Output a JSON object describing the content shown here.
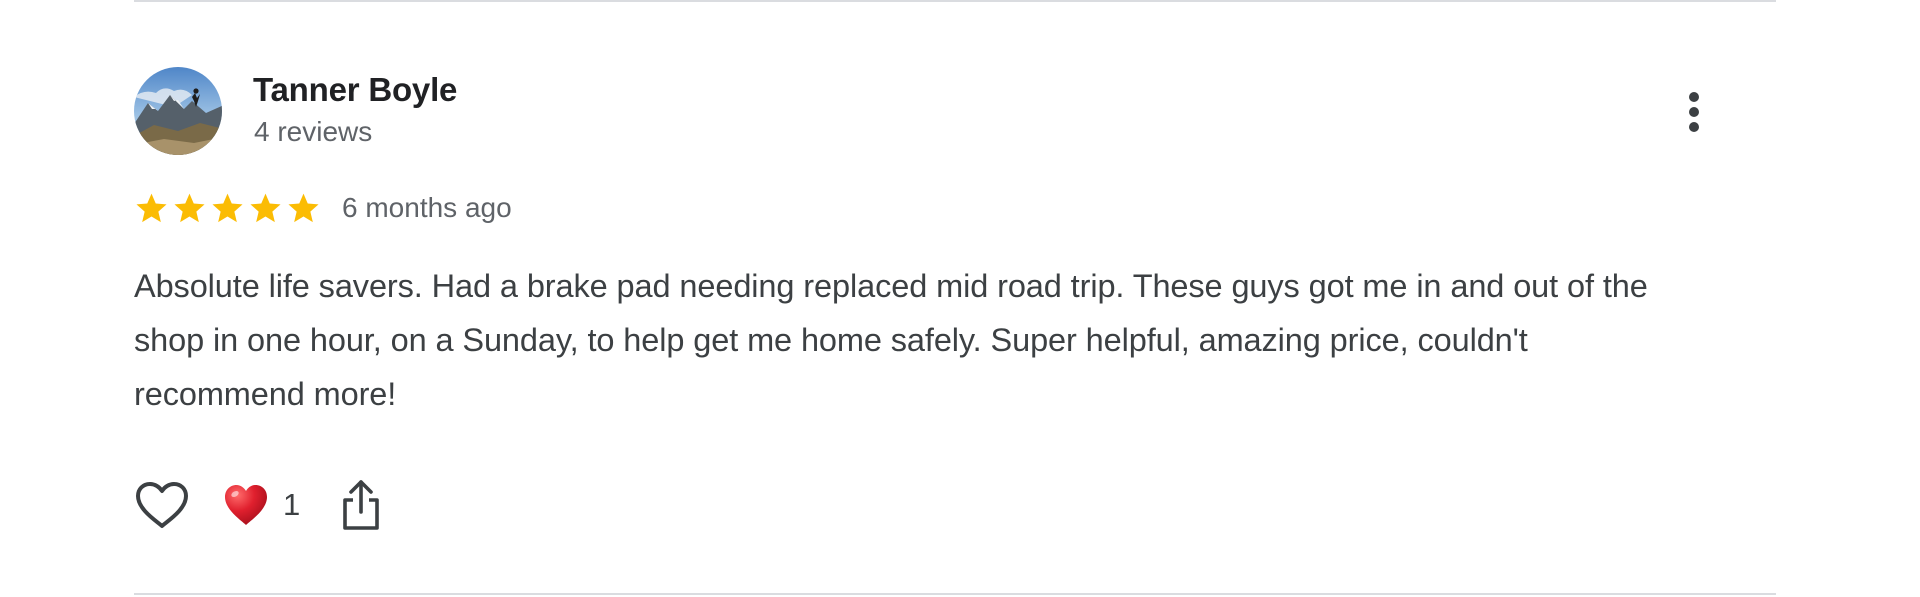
{
  "review": {
    "author": {
      "name": "Tanner Boyle",
      "meta": "4 reviews",
      "avatar_icon": "profile-photo-mountain"
    },
    "rating": 5,
    "rating_max": 5,
    "star_color": "#fbbc04",
    "date": "6 months ago",
    "text": "Absolute life savers. Had a brake pad needing replaced mid road trip. These guys got me in and out of the shop in one hour, on a Sunday, to help get me home safely. Super helpful, amazing price, couldn't recommend more!",
    "menu_icon": "more-vert-icon",
    "actions": {
      "like_icon": "heart-outline-icon",
      "reaction_icon": "red-heart-icon",
      "reaction_count": "1",
      "reaction_color": "#e0202e",
      "share_icon": "share-icon"
    }
  }
}
